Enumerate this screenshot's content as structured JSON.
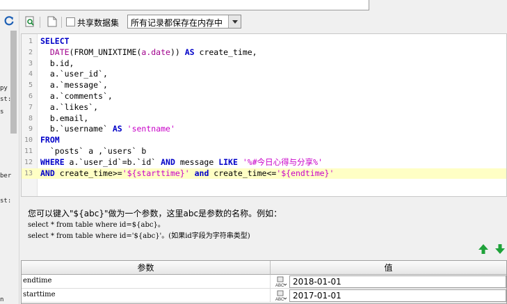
{
  "toolbar": {
    "share_label": "共享数据集",
    "mode_value": "所有记录都保存在内存中"
  },
  "left_fragments": [
    "py",
    "st:",
    "s",
    "ber",
    "st:",
    "n"
  ],
  "editor": {
    "lines": [
      {
        "n": "1",
        "tokens": [
          {
            "t": "SELECT",
            "c": "kw"
          }
        ]
      },
      {
        "n": "2",
        "tokens": [
          {
            "t": "  DATE",
            "c": "fn"
          },
          {
            "t": "(FROM_UNIXTIME(",
            "c": ""
          },
          {
            "t": "a.date",
            "c": "fn"
          },
          {
            "t": ")) ",
            "c": ""
          },
          {
            "t": "AS",
            "c": "kw"
          },
          {
            "t": " create_time,",
            "c": ""
          }
        ]
      },
      {
        "n": "3",
        "tokens": [
          {
            "t": "  b.id,",
            "c": ""
          }
        ]
      },
      {
        "n": "4",
        "tokens": [
          {
            "t": "  a.`user_id`,",
            "c": ""
          }
        ]
      },
      {
        "n": "5",
        "tokens": [
          {
            "t": "  a.`message`,",
            "c": ""
          }
        ]
      },
      {
        "n": "6",
        "tokens": [
          {
            "t": "  a.`comments`,",
            "c": ""
          }
        ]
      },
      {
        "n": "7",
        "tokens": [
          {
            "t": "  a.`likes`,",
            "c": ""
          }
        ]
      },
      {
        "n": "8",
        "tokens": [
          {
            "t": "  b.email,",
            "c": ""
          }
        ]
      },
      {
        "n": "9",
        "tokens": [
          {
            "t": "  b.`username` ",
            "c": ""
          },
          {
            "t": "AS",
            "c": "kw"
          },
          {
            "t": " ",
            "c": ""
          },
          {
            "t": "'sentname'",
            "c": "str"
          }
        ]
      },
      {
        "n": "10",
        "tokens": [
          {
            "t": "FROM",
            "c": "kw"
          }
        ]
      },
      {
        "n": "11",
        "tokens": [
          {
            "t": "  `posts` a ,`users` b",
            "c": ""
          }
        ]
      },
      {
        "n": "12",
        "tokens": [
          {
            "t": "WHERE",
            "c": "kw"
          },
          {
            "t": " a.`user_id`=b.`id` ",
            "c": ""
          },
          {
            "t": "AND",
            "c": "kw"
          },
          {
            "t": " message ",
            "c": ""
          },
          {
            "t": "LIKE",
            "c": "kw"
          },
          {
            "t": " ",
            "c": ""
          },
          {
            "t": "'%#今日心得与分享%'",
            "c": "str"
          }
        ]
      },
      {
        "n": "13",
        "tokens": [
          {
            "t": "AND",
            "c": "kw"
          },
          {
            "t": " create_time>=",
            "c": ""
          },
          {
            "t": "'${starttime}'",
            "c": "str"
          },
          {
            "t": " ",
            "c": ""
          },
          {
            "t": "and",
            "c": "kw"
          },
          {
            "t": " create_time<=",
            "c": ""
          },
          {
            "t": "'${endtime}'",
            "c": "str"
          }
        ],
        "highlight": true
      }
    ]
  },
  "help": {
    "line1": "您可以键入\"${abc}\"做为一个参数，这里abc是参数的名称。例如：",
    "line2": "select * from table where id=${abc}。",
    "line3": "select * from table where id='${abc}'。(如果id字段为字符串类型)"
  },
  "params": {
    "header_name": "参数",
    "header_value": "值",
    "rows": [
      {
        "name": "endtime",
        "value": "2018-01-01"
      },
      {
        "name": "starttime",
        "value": "2017-01-01"
      }
    ]
  },
  "colors": {
    "keyword": "#0000c8",
    "function": "#a0008c",
    "string": "#c800c8",
    "highlight_line": "#ffffc5",
    "arrow_green": "#1fa23a"
  },
  "icons": {
    "refresh": "refresh-icon",
    "preview": "preview-search-icon",
    "new_doc": "document-icon",
    "move_up": "arrow-up-icon",
    "move_down": "arrow-down-icon",
    "param_type": "abc-type-icon"
  }
}
